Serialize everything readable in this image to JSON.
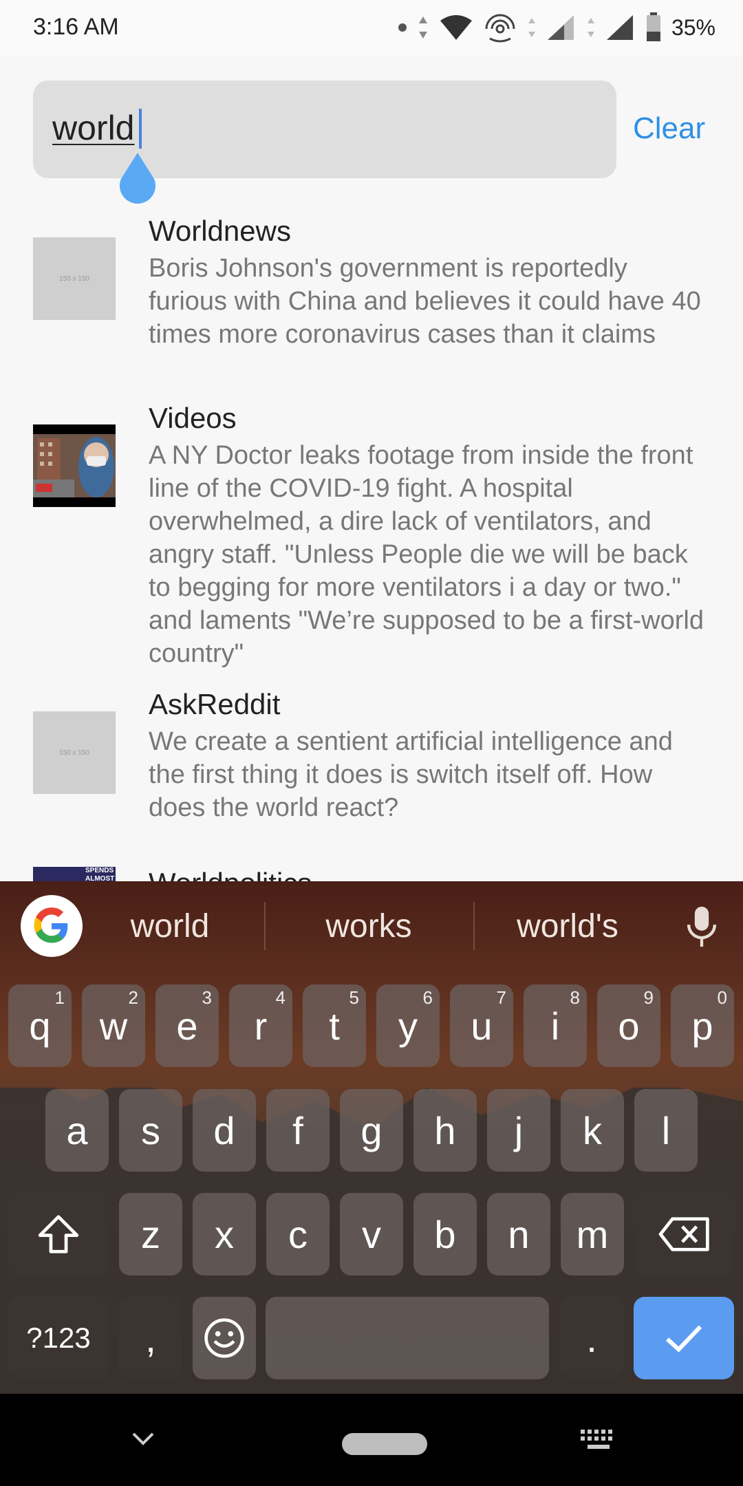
{
  "status_bar": {
    "time": "3:16 AM",
    "battery": "35%",
    "icons": [
      "dot-icon",
      "data-arrows-icon",
      "wifi-icon",
      "hotspot-icon",
      "signal-icon",
      "signal-icon",
      "battery-icon"
    ]
  },
  "search": {
    "query": "world",
    "clear_label": "Clear"
  },
  "results": [
    {
      "subreddit": "Worldnews",
      "title": "Boris Johnson's government is reportedly furious with China and believes it could have 40 times more coronavirus cases than it claims",
      "thumbnail": "placeholder",
      "placeholder_text": "150 x 150"
    },
    {
      "subreddit": "Videos",
      "title": "A NY Doctor leaks footage from inside the front line of the COVID-19 fight. A hospital overwhelmed, a dire lack of ventilators, and angry staff. \"Unless People die we will be back to begging for more ventilators i a day or two.\" and laments \"We’re supposed to be a first-world country\"",
      "thumbnail": "video-still"
    },
    {
      "subreddit": "AskReddit",
      "title": "We create a sentient artificial intelligence and the first thing it does is switch itself off. How does the world react?",
      "thumbnail": "placeholder",
      "placeholder_text": "150 x 150"
    },
    {
      "subreddit": "Worldpolitics",
      "thumbnail_text": "SPENDS ALMOST"
    }
  ],
  "keyboard": {
    "suggestions": [
      "world",
      "works",
      "world's"
    ],
    "row1": [
      "q",
      "w",
      "e",
      "r",
      "t",
      "y",
      "u",
      "i",
      "o",
      "p"
    ],
    "row1_hints": [
      "1",
      "2",
      "3",
      "4",
      "5",
      "6",
      "7",
      "8",
      "9",
      "0"
    ],
    "row2": [
      "a",
      "s",
      "d",
      "f",
      "g",
      "h",
      "j",
      "k",
      "l"
    ],
    "row3": [
      "z",
      "x",
      "c",
      "v",
      "b",
      "n",
      "m"
    ],
    "symbols_label": "?123",
    "comma": ",",
    "period": "."
  },
  "colors": {
    "accent": "#2e8fe6",
    "enter_key": "#5b9cf0",
    "caret": "#4a7fe0"
  }
}
